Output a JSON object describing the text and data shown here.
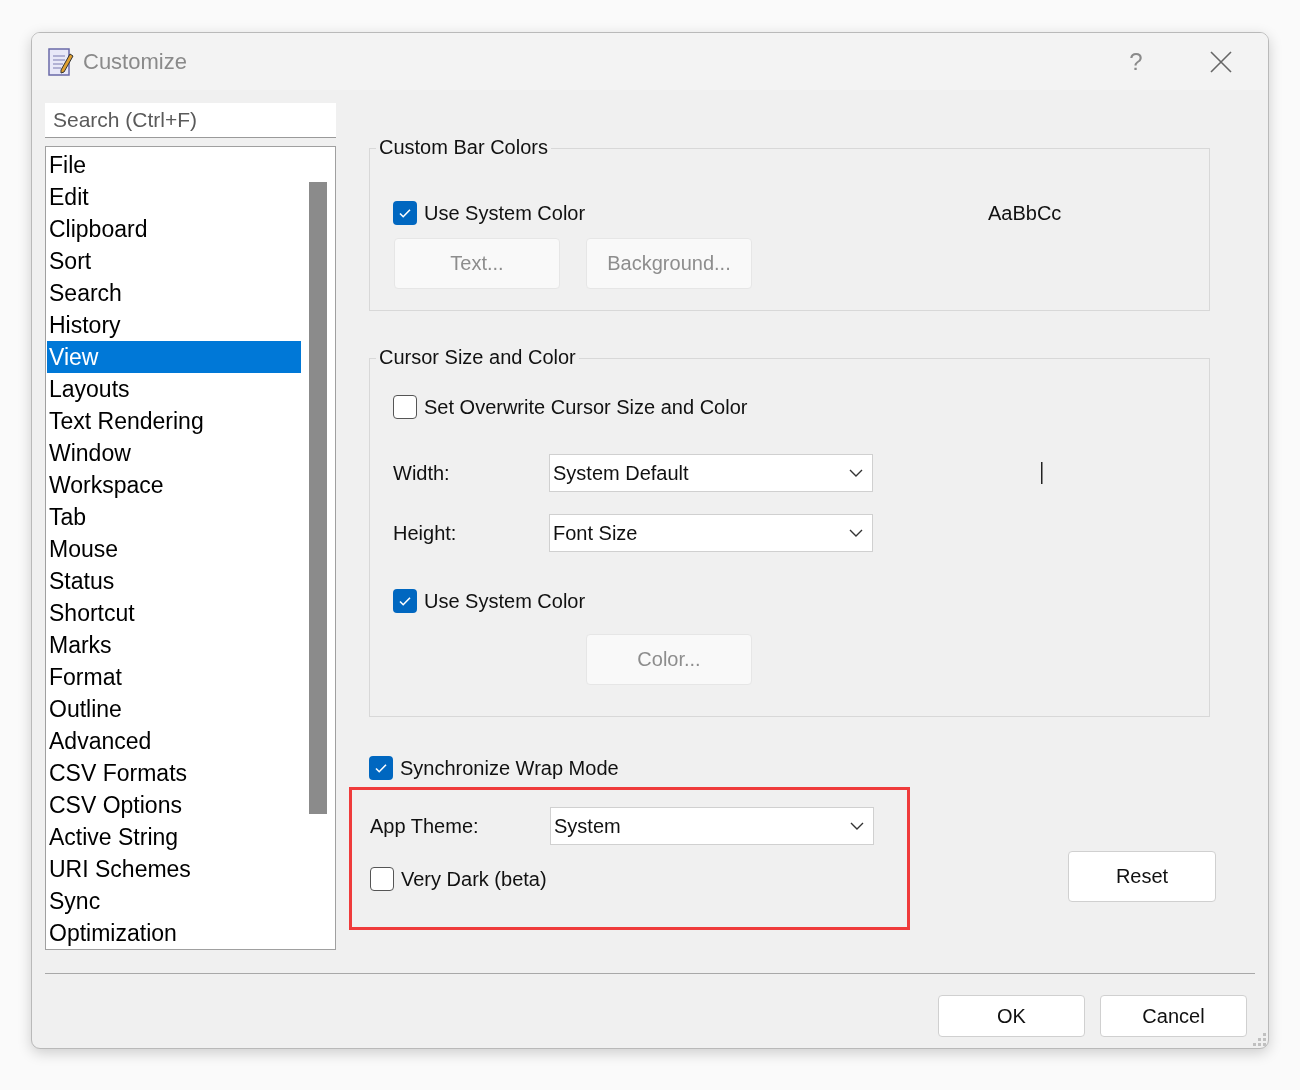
{
  "window": {
    "title": "Customize",
    "help_button": "?"
  },
  "search": {
    "placeholder": "Search (Ctrl+F)"
  },
  "categories": [
    {
      "label": "File",
      "selected": false
    },
    {
      "label": "Edit",
      "selected": false
    },
    {
      "label": "Clipboard",
      "selected": false
    },
    {
      "label": "Sort",
      "selected": false
    },
    {
      "label": "Search",
      "selected": false
    },
    {
      "label": "History",
      "selected": false
    },
    {
      "label": "View",
      "selected": true
    },
    {
      "label": "Layouts",
      "selected": false
    },
    {
      "label": "Text Rendering",
      "selected": false
    },
    {
      "label": "Window",
      "selected": false
    },
    {
      "label": "Workspace",
      "selected": false
    },
    {
      "label": "Tab",
      "selected": false
    },
    {
      "label": "Mouse",
      "selected": false
    },
    {
      "label": "Status",
      "selected": false
    },
    {
      "label": "Shortcut",
      "selected": false
    },
    {
      "label": "Marks",
      "selected": false
    },
    {
      "label": "Format",
      "selected": false
    },
    {
      "label": "Outline",
      "selected": false
    },
    {
      "label": "Advanced",
      "selected": false
    },
    {
      "label": "CSV Formats",
      "selected": false
    },
    {
      "label": "CSV Options",
      "selected": false
    },
    {
      "label": "Active String",
      "selected": false
    },
    {
      "label": "URI Schemes",
      "selected": false
    },
    {
      "label": "Sync",
      "selected": false
    },
    {
      "label": "Optimization",
      "selected": false
    }
  ],
  "custom_bar_colors": {
    "title": "Custom Bar Colors",
    "use_system_color": {
      "label": "Use System Color",
      "checked": true
    },
    "buttons": [
      {
        "label": "Text...",
        "disabled": true
      },
      {
        "label": "Background...",
        "disabled": true
      }
    ],
    "preview": "AaBbCc"
  },
  "cursor": {
    "title": "Cursor Size and Color",
    "set_overwrite": {
      "label": "Set Overwrite Cursor Size and Color",
      "checked": false
    },
    "width": {
      "label": "Width:",
      "value": "System Default"
    },
    "height": {
      "label": "Height:",
      "value": "Font Size"
    },
    "use_system_color": {
      "label": "Use System Color",
      "checked": true
    },
    "color_button": {
      "label": "Color...",
      "disabled": true
    }
  },
  "synchronize_wrap": {
    "label": "Synchronize Wrap Mode",
    "checked": true
  },
  "app_theme": {
    "label": "App Theme:",
    "value": "System"
  },
  "very_dark": {
    "label": "Very Dark (beta)",
    "checked": false
  },
  "reset_button": "Reset",
  "dialog_buttons": [
    "OK",
    "Cancel"
  ]
}
